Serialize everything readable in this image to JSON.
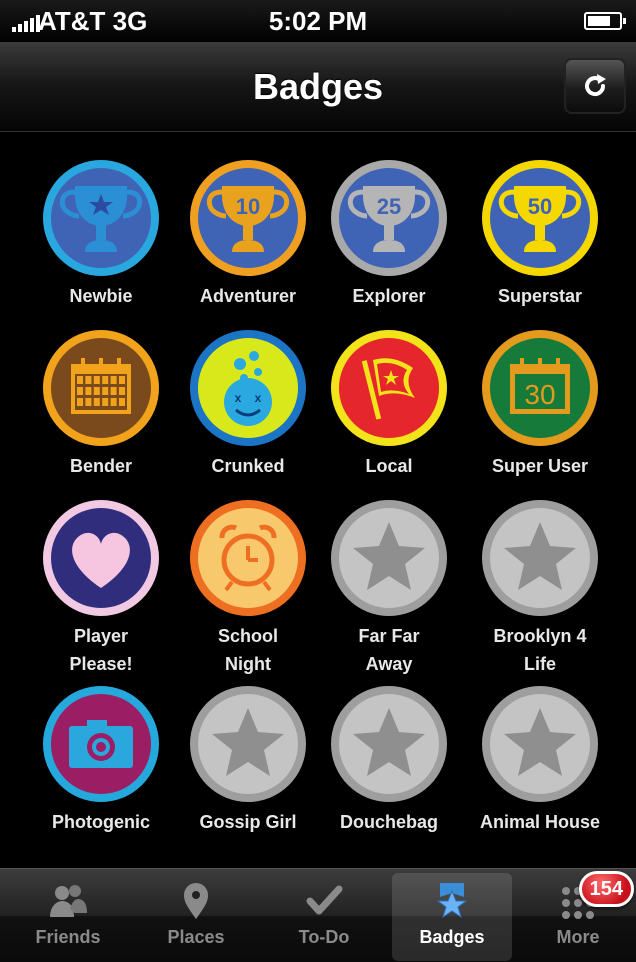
{
  "status_bar": {
    "carrier": "AT&T  3G",
    "time": "5:02 PM"
  },
  "nav": {
    "title": "Badges"
  },
  "badges": [
    {
      "label": "Newbie",
      "icon": "trophy-star",
      "unlocked": true,
      "ring": "#29a8e0",
      "bg": "#3f63b5",
      "fg": "#2b8fd6",
      "number": ""
    },
    {
      "label": "Adventurer",
      "icon": "trophy-number",
      "unlocked": true,
      "ring": "#f0a020",
      "bg": "#3f63b5",
      "fg": "#e9a21e",
      "number": "10"
    },
    {
      "label": "Explorer",
      "icon": "trophy-number",
      "unlocked": true,
      "ring": "#a9a9a9",
      "bg": "#3f63b5",
      "fg": "#b5b5b5",
      "number": "25"
    },
    {
      "label": "Superstar",
      "icon": "trophy-number",
      "unlocked": true,
      "ring": "#f5d800",
      "bg": "#3f63b5",
      "fg": "#f5d800",
      "number": "50"
    },
    {
      "label": "Bender",
      "icon": "calendar",
      "unlocked": true,
      "ring": "#f2a31c",
      "bg": "#7b4a1c",
      "fg": "#f2a31c",
      "number": ""
    },
    {
      "label": "Crunked",
      "icon": "bubble-face",
      "unlocked": true,
      "ring": "#1b74c4",
      "bg": "#d9e81a",
      "fg": "#2aa8e0",
      "number": ""
    },
    {
      "label": "Local",
      "icon": "flag",
      "unlocked": true,
      "ring": "#f2e31a",
      "bg": "#e5262d",
      "fg": "#e5262d",
      "number": ""
    },
    {
      "label": "Super User",
      "icon": "calendar-number",
      "unlocked": true,
      "ring": "#e39a1d",
      "bg": "#157a3a",
      "fg": "#e39a1d",
      "number": "30"
    },
    {
      "label": "Player\nPlease!",
      "icon": "heart",
      "unlocked": true,
      "ring": "#f2c9e2",
      "bg": "#302d7d",
      "fg": "#f6c5df",
      "number": ""
    },
    {
      "label": "School\nNight",
      "icon": "alarm-clock",
      "unlocked": true,
      "ring": "#ef6f22",
      "bg": "#f7c96c",
      "fg": "#ef6f22",
      "number": ""
    },
    {
      "label": "Far Far\nAway",
      "icon": "locked-star",
      "unlocked": false,
      "ring": "#9e9e9e",
      "bg": "#c4c4c4",
      "fg": "#8f8f8f",
      "number": ""
    },
    {
      "label": "Brooklyn 4\nLife",
      "icon": "locked-star",
      "unlocked": false,
      "ring": "#9e9e9e",
      "bg": "#c4c4c4",
      "fg": "#8f8f8f",
      "number": ""
    },
    {
      "label": "Photogenic",
      "icon": "camera",
      "unlocked": true,
      "ring": "#25a9dd",
      "bg": "#9b1d64",
      "fg": "#2aa8dd",
      "number": ""
    },
    {
      "label": "Gossip Girl",
      "icon": "locked-star",
      "unlocked": false,
      "ring": "#9e9e9e",
      "bg": "#c4c4c4",
      "fg": "#8f8f8f",
      "number": ""
    },
    {
      "label": "Douchebag",
      "icon": "locked-star",
      "unlocked": false,
      "ring": "#9e9e9e",
      "bg": "#c4c4c4",
      "fg": "#8f8f8f",
      "number": ""
    },
    {
      "label": "Animal House",
      "icon": "locked-star",
      "unlocked": false,
      "ring": "#9e9e9e",
      "bg": "#c4c4c4",
      "fg": "#8f8f8f",
      "number": ""
    }
  ],
  "tabs": [
    {
      "label": "Friends",
      "icon": "friends-icon",
      "selected": false
    },
    {
      "label": "Places",
      "icon": "pin-icon",
      "selected": false
    },
    {
      "label": "To-Do",
      "icon": "checkmark-icon",
      "selected": false
    },
    {
      "label": "Badges",
      "icon": "badge-icon",
      "selected": true
    },
    {
      "label": "More",
      "icon": "more-dots-icon",
      "selected": false,
      "notification": "154"
    }
  ]
}
